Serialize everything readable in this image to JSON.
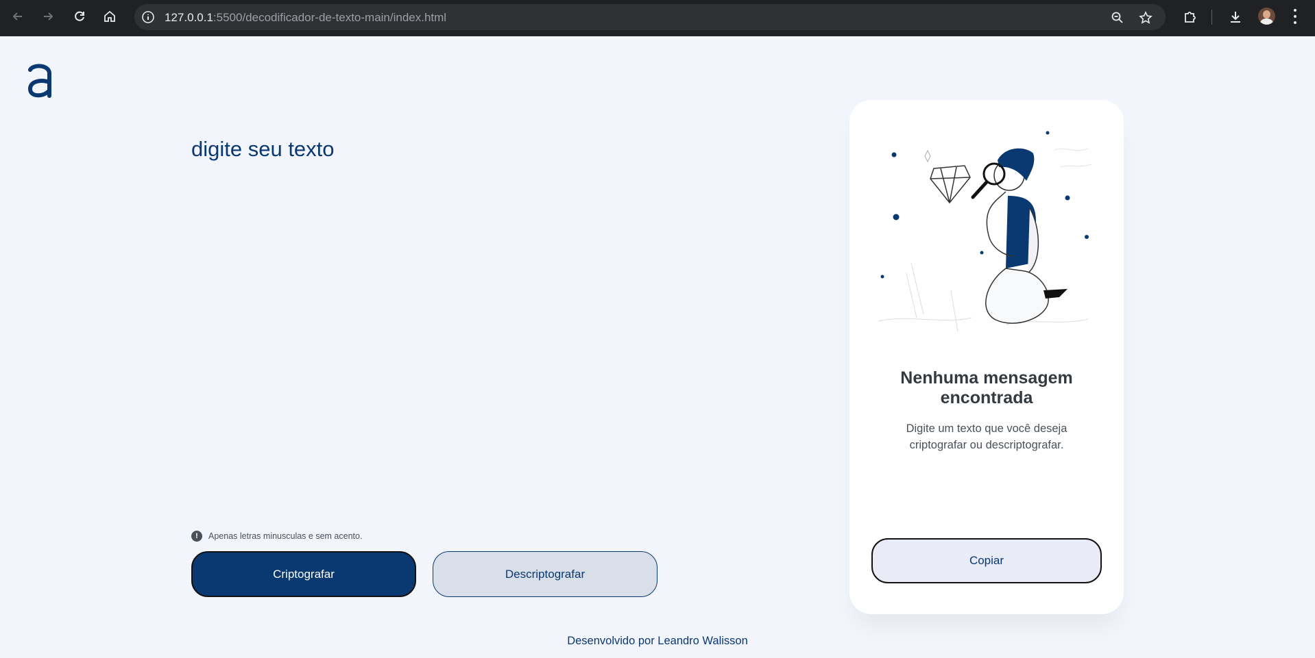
{
  "browser": {
    "url_host": "127.0.0.1",
    "url_rest": ":5500/decodificador-de-texto-main/index.html",
    "icons": {
      "back": "arrow-left-icon",
      "forward": "arrow-right-icon",
      "reload": "reload-icon",
      "home": "home-icon",
      "site_info": "info-icon",
      "zoom": "zoom-icon",
      "bookmark": "star-icon",
      "extensions": "puzzle-icon",
      "downloads": "download-icon",
      "profile": "avatar",
      "menu": "kebab-menu-icon"
    }
  },
  "header": {
    "logo_icon": "alura-logo-icon"
  },
  "editor": {
    "placeholder": "digite seu texto",
    "warning_text": "Apenas letras minusculas e sem acento.",
    "warning_icon": "exclamation-circle-icon"
  },
  "actions": {
    "encrypt_label": "Criptografar",
    "decrypt_label": "Descriptografar"
  },
  "output": {
    "illustration": "person-with-magnifier-illustration",
    "title": "Nenhuma mensagem encontrada",
    "text": "Digite um texto que você deseja criptografar ou descriptografar.",
    "copy_label": "Copiar"
  },
  "footer": {
    "text": "Desenvolvido por Leandro Walisson"
  },
  "colors": {
    "brand": "#0a3871",
    "page_bg": "#f3f5fc",
    "secondary_button_bg": "#d8dfe8",
    "copy_button_bg": "#e9ebf7"
  }
}
